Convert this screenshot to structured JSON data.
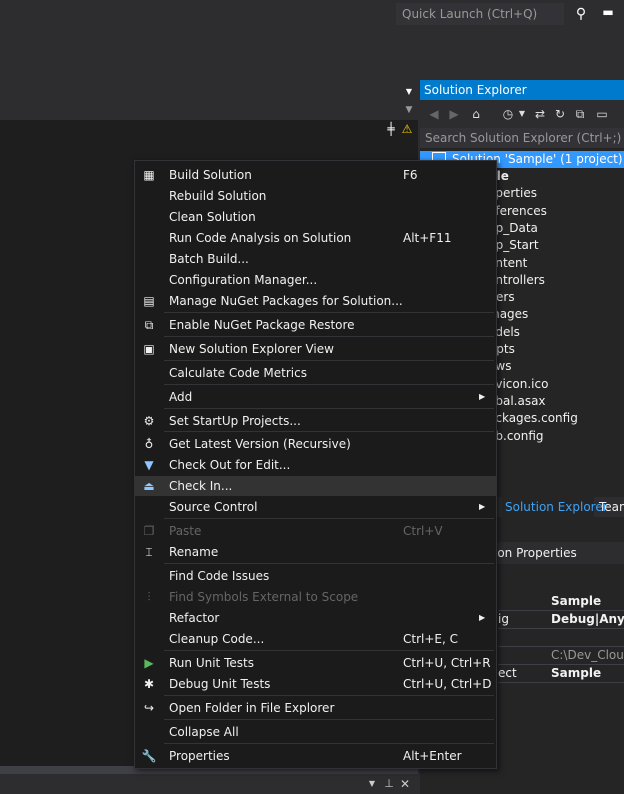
{
  "top": {
    "quick_launch_placeholder": "Quick Launch (Ctrl+Q)"
  },
  "solution_explorer": {
    "title": "Solution Explorer",
    "search_placeholder": "Search Solution Explorer (Ctrl+;)",
    "selected": "Solution 'Sample' (1 project)",
    "items": [
      "ple",
      "operties",
      "eferences",
      "pp_Data",
      "pp_Start",
      "ontent",
      "ontrollers",
      "lters",
      "mages",
      "odels",
      "ripts",
      "ews",
      "avicon.ico",
      "obal.asax",
      "ackages.config",
      "eb.config"
    ]
  },
  "tabs": {
    "solution_explorer": "Solution Explorer",
    "team": "Team"
  },
  "properties": {
    "title": "ion Properties",
    "rows": [
      {
        "name": "",
        "value": "Sample"
      },
      {
        "name": "ig",
        "value": "Debug|Any CPU"
      },
      {
        "name": "",
        "value": ""
      },
      {
        "name": "",
        "value": "C:\\Dev_Cloud\\"
      },
      {
        "name": "ect",
        "value": "Sample"
      }
    ]
  },
  "menu": {
    "items": [
      {
        "label": "Build Solution",
        "shortcut": "F6",
        "icon": "build-icon",
        "glyph": "▦"
      },
      {
        "label": "Rebuild Solution",
        "shortcut": ""
      },
      {
        "label": "Clean Solution",
        "shortcut": ""
      },
      {
        "label": "Run Code Analysis on Solution",
        "shortcut": "Alt+F11"
      },
      {
        "label": "Batch Build...",
        "shortcut": ""
      },
      {
        "label": "Configuration Manager...",
        "shortcut": ""
      },
      {
        "label": "Manage NuGet Packages for Solution...",
        "shortcut": "",
        "icon": "nuget-icon",
        "glyph": "▤"
      },
      {
        "label": "Enable NuGet Package Restore",
        "shortcut": "",
        "icon": "package-restore-icon",
        "glyph": "⧉"
      },
      {
        "label": "New Solution Explorer View",
        "shortcut": "",
        "icon": "new-view-icon",
        "glyph": "▣"
      },
      {
        "label": "Calculate Code Metrics",
        "shortcut": ""
      },
      {
        "label": "Add",
        "shortcut": "",
        "submenu": true
      },
      {
        "label": "Set StartUp Projects...",
        "shortcut": "",
        "icon": "gear-icon",
        "glyph": "⚙"
      },
      {
        "label": "Get Latest Version (Recursive)",
        "shortcut": "",
        "icon": "get-latest-icon",
        "glyph": "♁"
      },
      {
        "label": "Check Out for Edit...",
        "shortcut": "",
        "icon": "check-out-icon",
        "glyph": "▼"
      },
      {
        "label": "Check In...",
        "shortcut": "",
        "icon": "check-in-icon",
        "glyph": "⏏"
      },
      {
        "label": "Source Control",
        "shortcut": "",
        "submenu": true
      },
      {
        "label": "Paste",
        "shortcut": "Ctrl+V",
        "icon": "paste-icon",
        "glyph": "❐"
      },
      {
        "label": "Rename",
        "shortcut": "",
        "icon": "rename-icon",
        "glyph": "⌶"
      },
      {
        "label": "Find Code Issues",
        "shortcut": ""
      },
      {
        "label": "Find Symbols External to Scope",
        "shortcut": "",
        "icon": "find-symbols-icon",
        "glyph": "⫶"
      },
      {
        "label": "Refactor",
        "shortcut": "",
        "submenu": true
      },
      {
        "label": "Cleanup Code...",
        "shortcut": "Ctrl+E, C"
      },
      {
        "label": "Run Unit Tests",
        "shortcut": "Ctrl+U, Ctrl+R",
        "icon": "play-icon",
        "glyph": "▶"
      },
      {
        "label": "Debug Unit Tests",
        "shortcut": "Ctrl+U, Ctrl+D",
        "icon": "bug-icon",
        "glyph": "✱"
      },
      {
        "label": "Open Folder in File Explorer",
        "shortcut": "",
        "icon": "open-folder-icon",
        "glyph": "↪"
      },
      {
        "label": "Collapse All",
        "shortcut": ""
      },
      {
        "label": "Properties",
        "shortcut": "Alt+Enter",
        "icon": "wrench-icon",
        "glyph": "🔧"
      }
    ]
  }
}
